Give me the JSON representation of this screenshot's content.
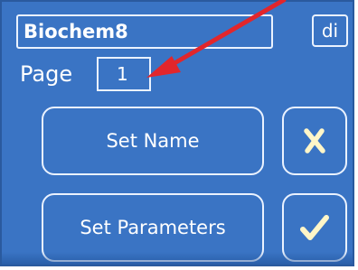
{
  "device": {
    "name_field_value": "Biochem8",
    "di_button_label": "di",
    "page_label": "Page",
    "page_value": "1"
  },
  "menu": {
    "set_name_label": "Set Name",
    "set_parameters_label": "Set Parameters"
  },
  "icons": {
    "cancel": "x-mark-icon",
    "confirm": "checkmark-icon",
    "annotation": "red-arrow-icon"
  },
  "colors": {
    "screen_background": "#3a74c4",
    "foreground": "#ffffff",
    "outline": "#eaf2ff",
    "icon_glyph": "#fff6c8",
    "annotation_arrow": "#e2262b"
  }
}
